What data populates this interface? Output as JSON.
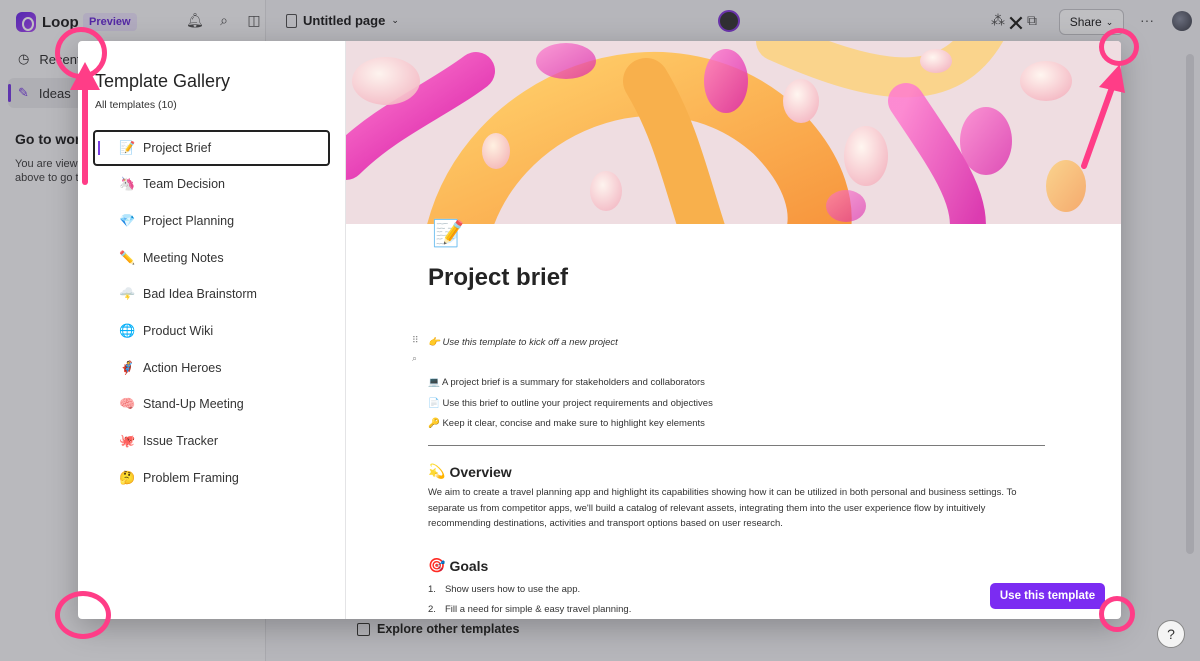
{
  "app": {
    "brand_name": "Loop",
    "preview_badge": "Preview",
    "nav": {
      "recent": "Recent",
      "ideas": "Ideas"
    },
    "side_heading": "Go to workspace",
    "side_text": "You are viewing a page. Select a workspace above to go to it."
  },
  "topbar": {
    "page_title": "Untitled page",
    "share_label": "Share",
    "more_label": "···"
  },
  "gallery": {
    "title": "Template Gallery",
    "subtitle": "All templates (10)",
    "templates": [
      {
        "label": "Project Brief",
        "emoji": "📝",
        "active": true
      },
      {
        "label": "Team Decision",
        "emoji": "🦄"
      },
      {
        "label": "Project Planning",
        "emoji": "💎"
      },
      {
        "label": "Meeting Notes",
        "emoji": "✏️"
      },
      {
        "label": "Bad Idea Brainstorm",
        "emoji": "🌩️"
      },
      {
        "label": "Product Wiki",
        "emoji": "🌐"
      },
      {
        "label": "Action Heroes",
        "emoji": "🦸"
      },
      {
        "label": "Stand-Up Meeting",
        "emoji": "🧠"
      },
      {
        "label": "Issue Tracker",
        "emoji": "🐙"
      },
      {
        "label": "Problem Framing",
        "emoji": "🤔"
      }
    ]
  },
  "preview": {
    "doc_icon": "📝",
    "title": "Project brief",
    "intro": "👉 Use this template to kick off a new project",
    "bullets": [
      "💻 A project brief is a summary for stakeholders and collaborators",
      "📄 Use this brief to outline your project requirements and objectives",
      "🔑 Keep it clear, concise and make sure to highlight key elements"
    ],
    "overview_emoji": "💫",
    "overview_heading": "Overview",
    "overview_text": "We aim to create a travel planning app and highlight its capabilities showing how it can be utilized in both personal and business settings. To separate us from competitor apps, we'll build a catalog of relevant assets, integrating them into the user experience flow by intuitively recommending destinations, activities and transport options based on user research.",
    "goals_emoji": "🎯",
    "goals_heading": "Goals",
    "goals": [
      {
        "num": "1.",
        "text": "Show users how to use the app."
      },
      {
        "num": "2.",
        "text": "Fill a need for simple & easy travel planning."
      }
    ],
    "use_template_label": "Use this template"
  },
  "footer": {
    "explore_label": "Explore other templates",
    "help_label": "?"
  },
  "colors": {
    "accent": "#7b2cf2",
    "annotation": "#ff3d87"
  }
}
